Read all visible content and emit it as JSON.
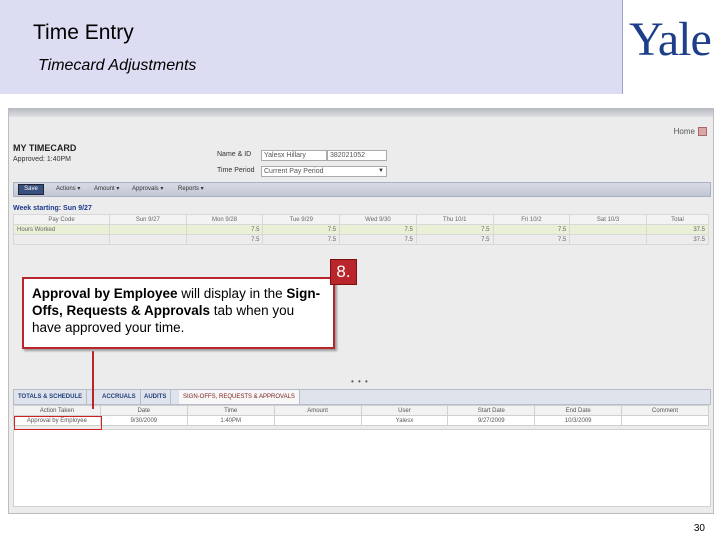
{
  "slide": {
    "title": "Time Entry",
    "subtitle": "Timecard Adjustments",
    "logo_text": "Yale",
    "page_number": "30"
  },
  "app": {
    "home_link": "Home",
    "section_title": "MY TIMECARD",
    "approved_text": "Approved: 1:40PM",
    "name_label": "Name & ID",
    "name_value": "Yalesx Hillary",
    "id_value": "382021052",
    "time_period_label": "Time Period",
    "time_period_value": "Current Pay Period",
    "toolbar": {
      "save": "Save",
      "actions": "Actions ▾",
      "amount": "Amount ▾",
      "approvals": "Approvals ▾",
      "reports": "Reports ▾"
    },
    "week_label": "Week starting: Sun 9/27",
    "grid_headers": [
      "Pay Code",
      "Sun 9/27",
      "Mon 9/28",
      "Tue 9/29",
      "Wed 9/30",
      "Thu 10/1",
      "Fri 10/2",
      "Sat 10/3",
      "Total"
    ],
    "grid_rows": [
      [
        "Hours Worked",
        "",
        "7.5",
        "7.5",
        "7.5",
        "7.5",
        "7.5",
        "",
        "37.5"
      ],
      [
        "",
        "",
        "7.5",
        "7.5",
        "7.5",
        "7.5",
        "7.5",
        "",
        "37.5"
      ]
    ],
    "tabs": [
      "TOTALS & SCHEDULE",
      "ACCRUALS",
      "AUDITS",
      "SIGN-OFFS, REQUESTS & APPROVALS"
    ],
    "sub_headers": [
      "Action Taken",
      "Date",
      "Time",
      "Amount",
      "User",
      "Start Date",
      "End Date",
      "Comment"
    ],
    "sub_rows": [
      [
        "Approval by Employee",
        "9/30/2009",
        "1:40PM",
        "",
        "Yalesx",
        "9/27/2009",
        "10/3/2009",
        ""
      ]
    ]
  },
  "callout": {
    "number": "8.",
    "bold1": "Approval by Employee",
    "text1": " will display in the ",
    "bold2": "Sign-Offs, Requests & Approvals",
    "text2": " tab when you have approved your time."
  }
}
